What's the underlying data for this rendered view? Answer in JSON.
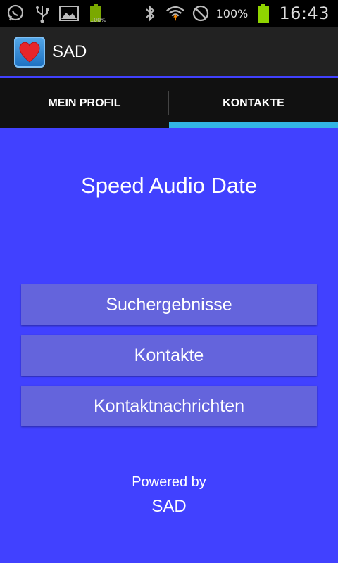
{
  "status_bar": {
    "icons": [
      "whatsapp-icon",
      "usb-icon",
      "gallery-icon",
      "battery-small-icon",
      "bluetooth-icon",
      "wifi-icon",
      "no-sim-icon",
      "battery-icon"
    ],
    "small_battery_text": "100%",
    "battery_percent": "100%",
    "time": "16:43",
    "battery_color": "#8fd400"
  },
  "action_bar": {
    "title": "SAD",
    "icon": "heart-icon"
  },
  "tabs": [
    {
      "label": "MEIN PROFIL",
      "selected": false
    },
    {
      "label": "KONTAKTE",
      "selected": true
    }
  ],
  "main": {
    "headline": "Speed Audio Date",
    "buttons": [
      {
        "label": "Suchergebnisse"
      },
      {
        "label": "Kontakte"
      },
      {
        "label": "Kontaktnachrichten"
      }
    ],
    "powered_by": "Powered by",
    "brand": "SAD"
  },
  "colors": {
    "background": "#4141ff",
    "button": "#6464dc",
    "tab_indicator": "#33b5e5"
  }
}
